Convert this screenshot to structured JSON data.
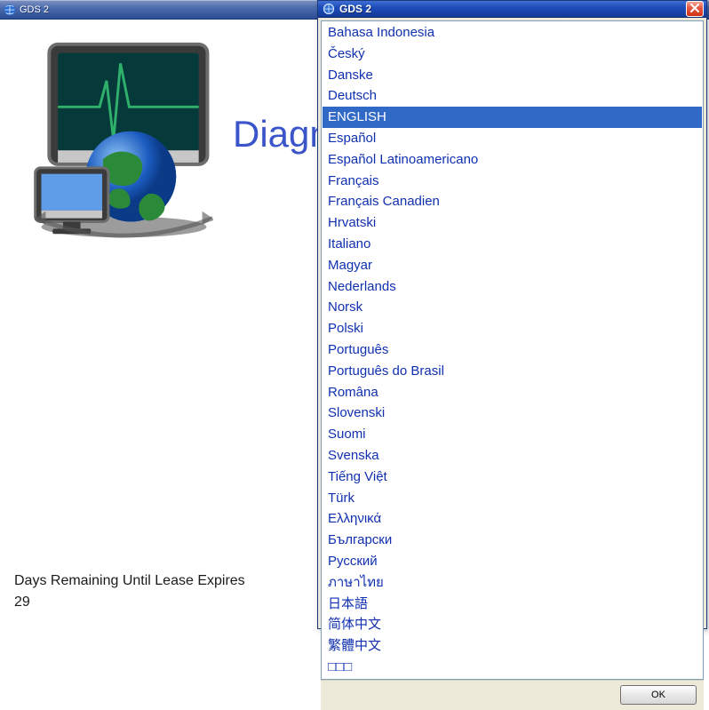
{
  "parent": {
    "title": "GDS 2",
    "headline": "Diagno",
    "lease_label": "Days Remaining Until Lease Expires",
    "lease_days": "29"
  },
  "dialog": {
    "title": "GDS 2",
    "ok_label": "OK",
    "selected_index": 4,
    "languages": [
      "Bahasa Indonesia",
      "Český",
      "Danske",
      "Deutsch",
      "ENGLISH",
      "Español",
      "Español Latinoamericano",
      "Français",
      "Français Canadien",
      "Hrvatski",
      "Italiano",
      "Magyar",
      "Nederlands",
      "Norsk",
      "Polski",
      "Português",
      "Português do Brasil",
      "Româna",
      "Slovenski",
      "Suomi",
      "Svenska",
      "Tiếng Việt",
      "Türk",
      "Ελληνικά",
      "Български",
      "Русский",
      "ภาษาไทย",
      "日本語",
      "简体中文",
      "繁體中文",
      "□□□"
    ]
  }
}
